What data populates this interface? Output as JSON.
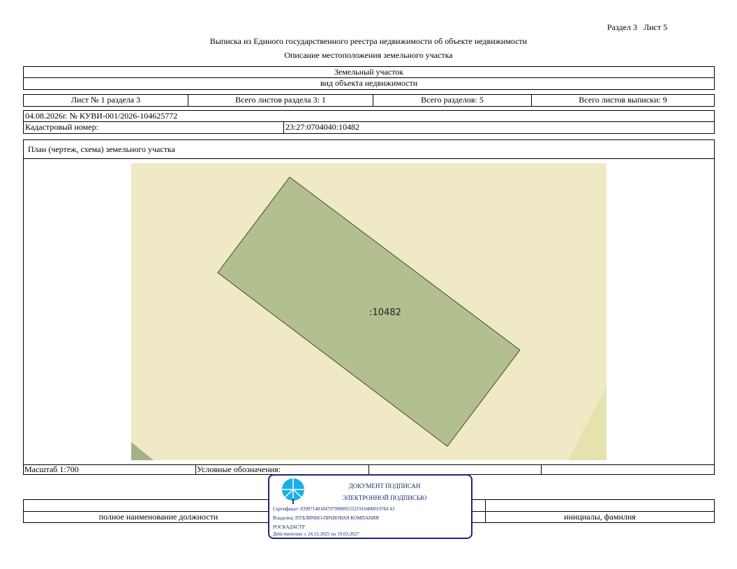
{
  "header": {
    "section_sheet": "Раздел 3   Лист 5",
    "title": "Выписка из Единого государственного реестра недвижимости об объекте недвижимости",
    "subtitle": "Описание местоположения земельного участка"
  },
  "object": {
    "type": "Земельный участок",
    "type_caption": "вид объекта недвижимости"
  },
  "sheet_info": {
    "sheet": "Лист № 1 раздела 3",
    "total_section_sheets": "Всего листов раздела 3: 1",
    "total_sections": "Всего разделов: 5",
    "total_extract_sheets": "Всего листов выписки: 9"
  },
  "doc": {
    "date_number": "04.08.2026г. № КУВИ-001/2026-104625772",
    "cadastral_label": "Кадастровый номер:",
    "cadastral_value": "23:27:0704040:10482"
  },
  "plan": {
    "title": "План (чертеж, схема) земельного участка",
    "parcel_label": ":10482",
    "colors": {
      "background": "#efeac5",
      "parcel": "#b3bf8f",
      "road": "#e6e2ae",
      "corner": "#a4b08a"
    }
  },
  "legend": {
    "scale": "Масштаб 1:700",
    "symbols": "Условные обозначения:"
  },
  "signature": {
    "position_caption": "полное наименование должности",
    "name_caption": "инициалы, фамилия"
  },
  "stamp": {
    "line1": "ДОКУМЕНТ ПОДПИСАН",
    "line2": "ЭЛЕКТРОННОЙ ПОДПИСЬЮ",
    "certificate": "Сертификат: 839971481847979980055521910400019784 43",
    "owner_line1": "Владелец: ПУБЛИЧНО-ПРАВОВАЯ КОМПАНИЯ",
    "owner_line2": "РОСКАДАСТР",
    "valid": "Действителен: с 24.12.2025 по 19.03.2027"
  }
}
